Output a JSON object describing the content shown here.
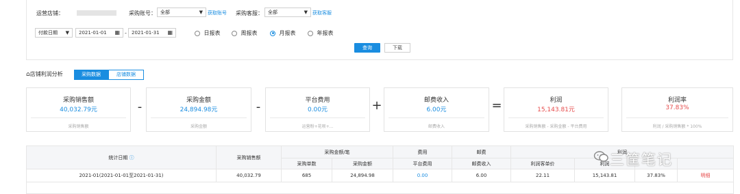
{
  "filters": {
    "store_label": "运营店铺：",
    "account_label": "采购账号：",
    "account_value": "全部",
    "account_link": "获取账号",
    "service_label": "采购客服：",
    "service_value": "全部",
    "service_link": "获取客服",
    "date_type": "付款日期",
    "date_start": "2021-01-01",
    "date_sep": "-",
    "date_end": "2021-01-31",
    "radio_day": "日报表",
    "radio_week": "周报表",
    "radio_month": "月报表",
    "radio_year": "年报表",
    "query_button": "查询",
    "download_button": "下载"
  },
  "analysis": {
    "title": "店铺利润分析",
    "tab_purchase": "采购数据",
    "tab_store": "店铺数据"
  },
  "cards": [
    {
      "title": "采购销售额",
      "value": "40,032.79元",
      "desc": "采购销售额"
    },
    {
      "title": "采购金额",
      "value": "24,894.98元",
      "desc": "采购金额"
    },
    {
      "title": "平台费用",
      "value": "0.00元",
      "desc": "运营粉+花呗+..."
    },
    {
      "title": "邮费收入",
      "value": "6.00元",
      "desc": "邮费收入"
    },
    {
      "title": "利润",
      "value": "15,143.81元",
      "desc": "采购销售额 - 采购金额 - 平台费用"
    },
    {
      "title": "利润率",
      "value": "37.83%",
      "desc": "利润 / 采购销售额 * 100%"
    }
  ],
  "operators": [
    "-",
    "-",
    "+",
    "="
  ],
  "table": {
    "h_date": "统计日期",
    "h_sales": "采购销售额",
    "h_amount_group": "采购金额/笔",
    "h_fee_group": "费用",
    "h_postage_group": "邮费",
    "h_profit_group": "利润",
    "h_count": "采购单数",
    "h_amount": "采购金额",
    "h_platform_fee": "平台费用",
    "h_postage_income": "邮费收入",
    "h_profit_per": "利润客单价",
    "h_profit": "利润",
    "rows": [
      {
        "date": "2021-01(2021-01-01至2021-01-31)",
        "sales": "40,032.79",
        "count": "685",
        "amount": "24,894.98",
        "fee": "0.00",
        "postage": "6.00",
        "per": "22.11",
        "profit": "15,143.81",
        "rate": "37.83%",
        "action": "明细"
      }
    ]
  },
  "watermark": "三筐笔记",
  "colors": {
    "accent": "#1a8de0",
    "negative": "#e64b4b"
  }
}
